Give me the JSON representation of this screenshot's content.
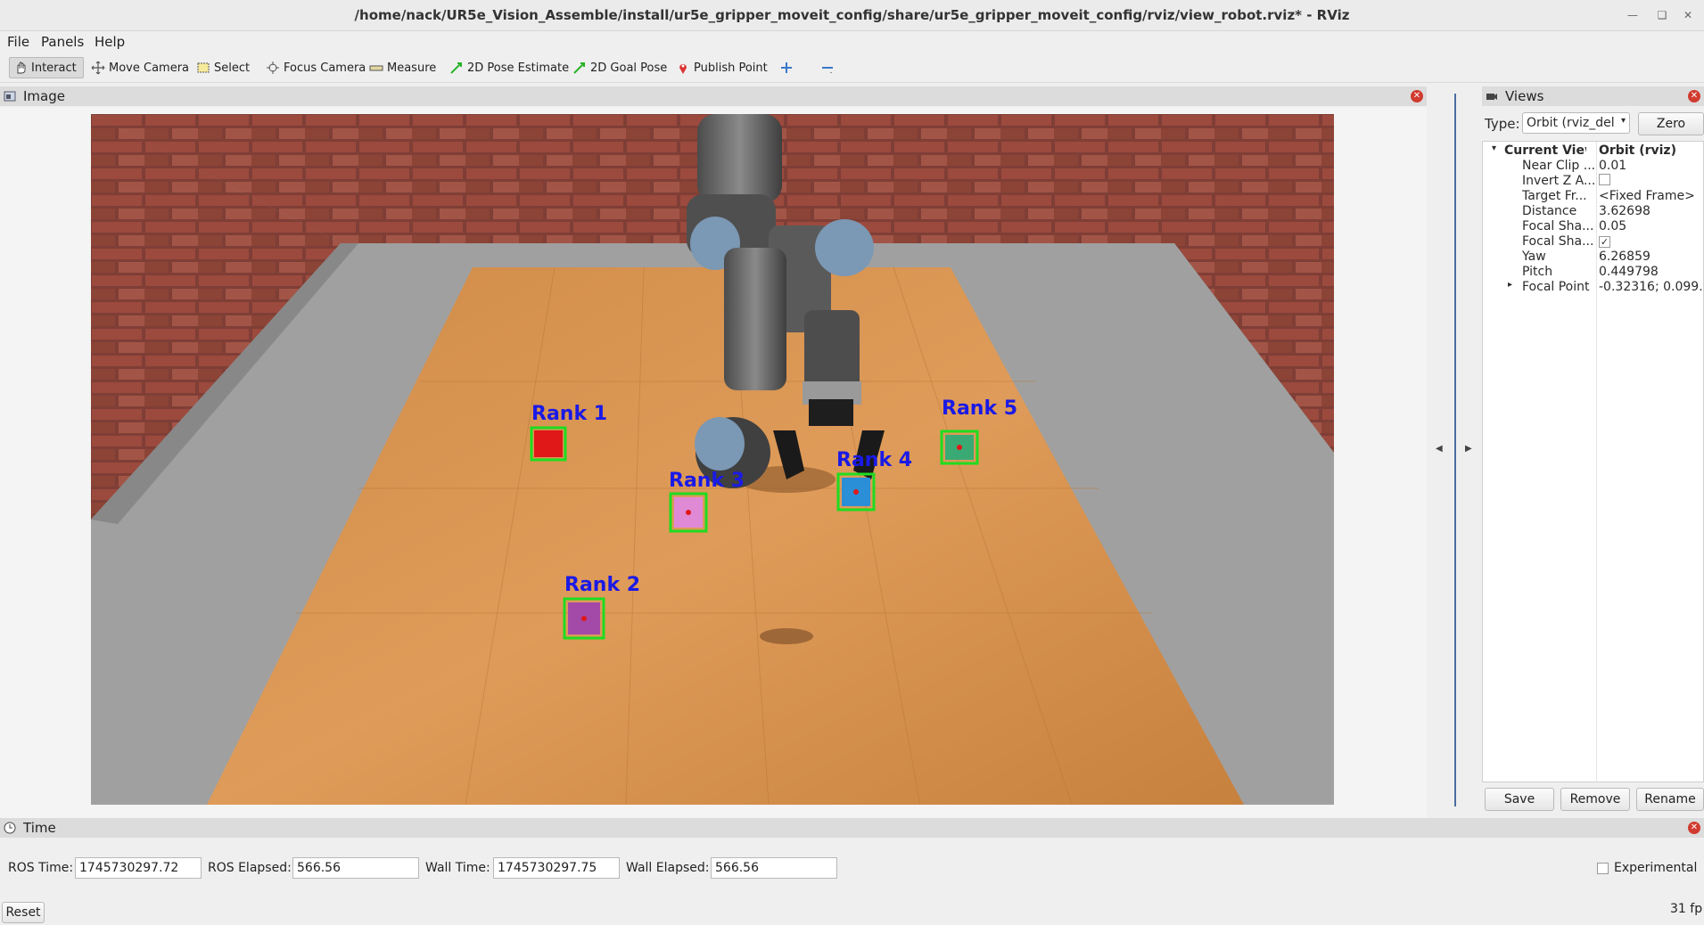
{
  "window": {
    "title": "/home/nack/UR5e_Vision_Assemble/install/ur5e_gripper_moveit_config/share/ur5e_gripper_moveit_config/rviz/view_robot.rviz* - RViz"
  },
  "menu": [
    {
      "label": "File"
    },
    {
      "label": "Panels"
    },
    {
      "label": "Help"
    }
  ],
  "toolbar": [
    {
      "label": "Interact",
      "icon": "hand-icon"
    },
    {
      "label": "Move Camera",
      "icon": "move-icon"
    },
    {
      "label": "Select",
      "icon": "select-icon"
    },
    {
      "label": "Focus Camera",
      "icon": "focus-icon"
    },
    {
      "label": "Measure",
      "icon": "ruler-icon"
    },
    {
      "label": "2D Pose Estimate",
      "icon": "green-arrow-icon"
    },
    {
      "label": "2D Goal Pose",
      "icon": "green-arrow-icon"
    },
    {
      "label": "Publish Point",
      "icon": "pin-icon"
    }
  ],
  "image_panel": {
    "title": "Image",
    "detections": [
      {
        "label": "Rank 1"
      },
      {
        "label": "Rank 2"
      },
      {
        "label": "Rank 3"
      },
      {
        "label": "Rank 4"
      },
      {
        "label": "Rank 5"
      }
    ]
  },
  "views_panel": {
    "title": "Views",
    "type_label": "Type:",
    "type_value": "Orbit (rviz_del",
    "zero_label": "Zero",
    "current_view": {
      "key": "Current View",
      "value": "Orbit (rviz)"
    },
    "properties": [
      {
        "key": "Near Clip ...",
        "value": "0.01"
      },
      {
        "key": "Invert Z A...",
        "value": ""
      },
      {
        "key": "Target Fr...",
        "value": "<Fixed Frame>"
      },
      {
        "key": "Distance",
        "value": "3.62698"
      },
      {
        "key": "Focal Sha...",
        "value": "0.05"
      },
      {
        "key": "Focal Sha...",
        "value": "✓"
      },
      {
        "key": "Yaw",
        "value": "6.26859"
      },
      {
        "key": "Pitch",
        "value": "0.449798"
      },
      {
        "key": "Focal Point",
        "value": "-0.32316; 0.099..."
      }
    ],
    "buttons": {
      "save": "Save",
      "remove": "Remove",
      "rename": "Rename"
    }
  },
  "time_panel": {
    "title": "Time",
    "ros_time_label": "ROS Time:",
    "ros_time": "1745730297.72",
    "ros_elapsed_label": "ROS Elapsed:",
    "ros_elapsed": "566.56",
    "wall_time_label": "Wall Time:",
    "wall_time": "1745730297.75",
    "wall_elapsed_label": "Wall Elapsed:",
    "wall_elapsed": "566.56",
    "experimental_label": "Experimental",
    "reset_label": "Reset",
    "fps": "31 fp"
  }
}
